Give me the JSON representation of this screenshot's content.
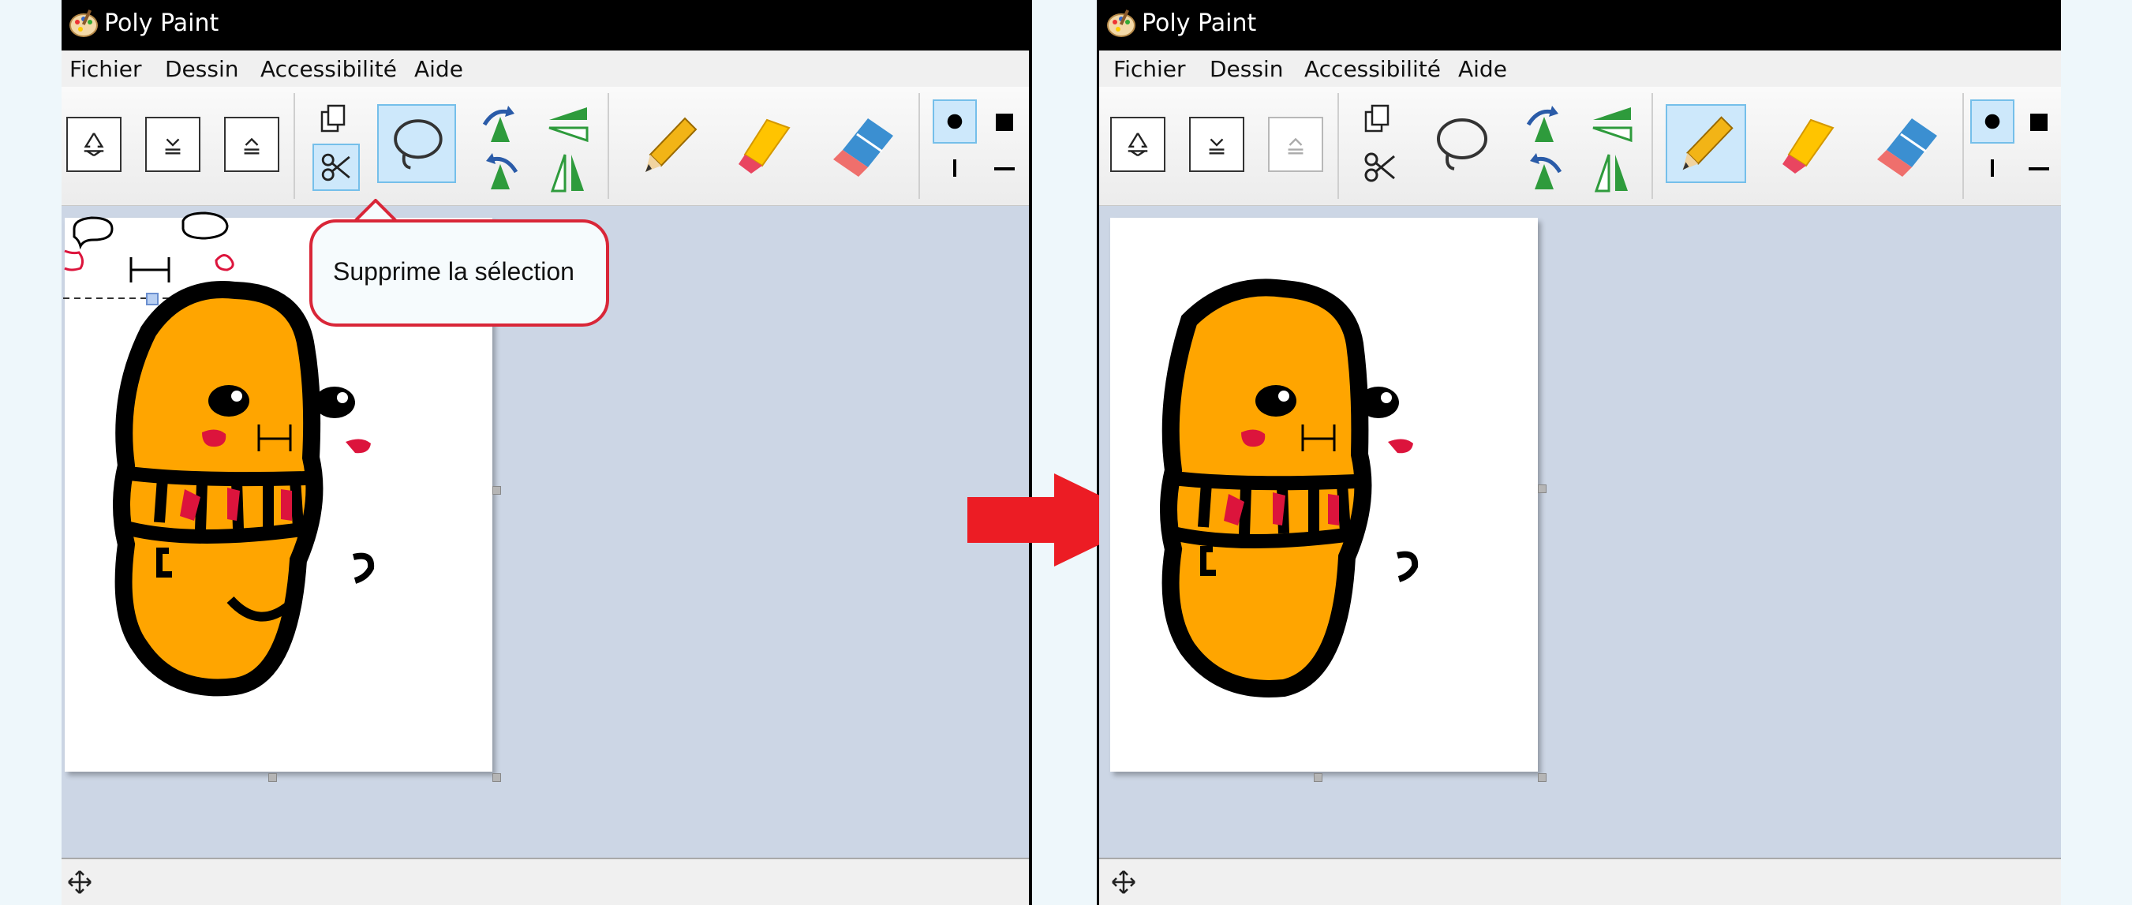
{
  "windows": [
    {
      "title": "Poly Paint",
      "menu": [
        "Fichier",
        "Dessin",
        "Accessibilité",
        "Aide"
      ],
      "redo_enabled": true,
      "selected_tools": [
        "cut",
        "lasso",
        "stroke-round"
      ],
      "tooltip": "Supprime la sélection"
    },
    {
      "title": "Poly Paint",
      "menu": [
        "Fichier",
        "Dessin",
        "Accessibilité",
        "Aide"
      ],
      "redo_enabled": false,
      "selected_tools": [
        "pencil",
        "stroke-round"
      ]
    }
  ],
  "icons": {
    "clear": "recycle-icon",
    "undo": "undo-icon",
    "redo": "redo-icon",
    "copy": "copy-icon",
    "cut": "scissors-icon",
    "lasso": "lasso-icon",
    "rotate": "rotate-icon",
    "flip": "flip-icon",
    "pencil": "pencil-icon",
    "highlighter": "highlighter-icon",
    "eraser": "eraser-icon",
    "move": "move-icon"
  },
  "colors": {
    "accent_selected": "#cde8fb",
    "tooltip_border": "#d92638",
    "arrow": "#ec1c24",
    "character_fill": "#ffa500",
    "cheek": "#dc143c"
  }
}
